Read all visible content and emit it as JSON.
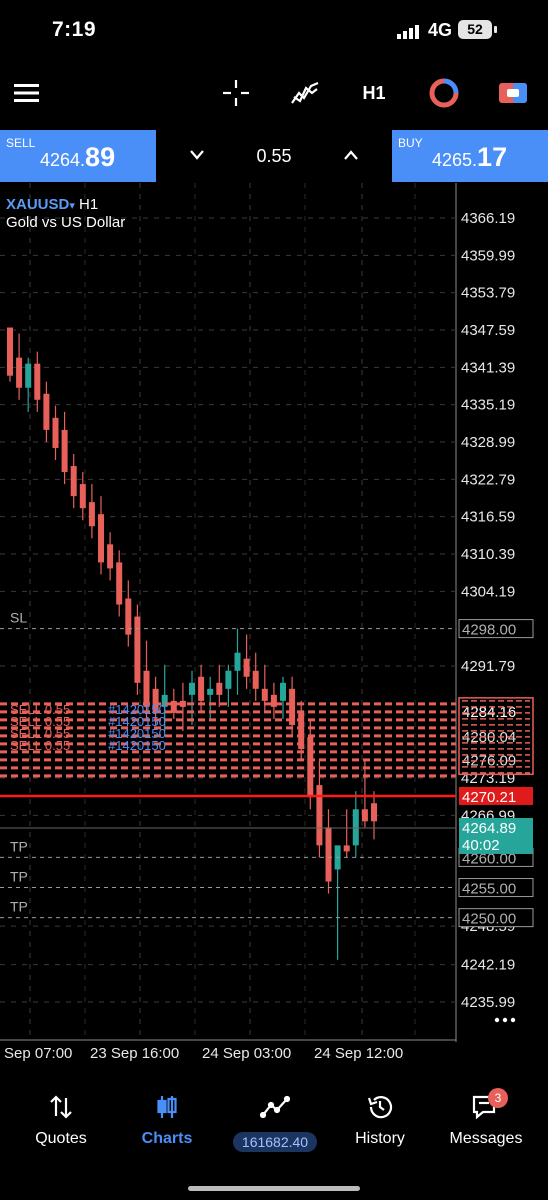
{
  "status": {
    "time": "7:19",
    "network": "4G",
    "battery": "52"
  },
  "toolbar": {
    "timeframe": "H1"
  },
  "trade": {
    "sell_label": "SELL",
    "sell_small": "4264.",
    "sell_big": "89",
    "buy_label": "BUY",
    "buy_small": "4265.",
    "buy_big": "17",
    "volume": "0.55"
  },
  "chart": {
    "symbol": "XAUUSD",
    "symbol_arrow": "▾",
    "timeframe": "H1",
    "description": "Gold vs US Dollar",
    "price_levels": [
      "4366.19",
      "4359.99",
      "4353.79",
      "4347.59",
      "4341.39",
      "4335.19",
      "4328.99",
      "4322.79",
      "4316.59",
      "4310.39",
      "4304.19",
      "4291.79",
      "4273.19",
      "4266.99",
      "4248.59",
      "4242.19",
      "4235.99"
    ],
    "time_labels": [
      "Sep 07:00",
      "23 Sep 16:00",
      "24 Sep 03:00",
      "24 Sep 12:00"
    ],
    "sl": {
      "label": "SL",
      "price": "4298.00"
    },
    "tp_levels": [
      {
        "label": "TP",
        "price": "4260.00"
      },
      {
        "label": "TP",
        "price": "4255.00"
      },
      {
        "label": "TP",
        "price": "4250.00"
      }
    ],
    "order_box_price": "4284.16",
    "order_box_obscured_1": "4280.04",
    "order_box_obscured_2": "4276.09",
    "current_line_price": "4270.21",
    "bid_price": "4264.89",
    "countdown": "40:02",
    "order_text_left": "SELL 0.55",
    "order_text_blue": "#1420150",
    "colors": {
      "bear": "#e8605a",
      "bull": "#26a69a",
      "accent": "#4a8ff7",
      "line": "#ff1a1a"
    }
  },
  "nav": {
    "quotes": "Quotes",
    "charts": "Charts",
    "account": "161682.40",
    "history": "History",
    "messages": "Messages",
    "badge": "3"
  }
}
